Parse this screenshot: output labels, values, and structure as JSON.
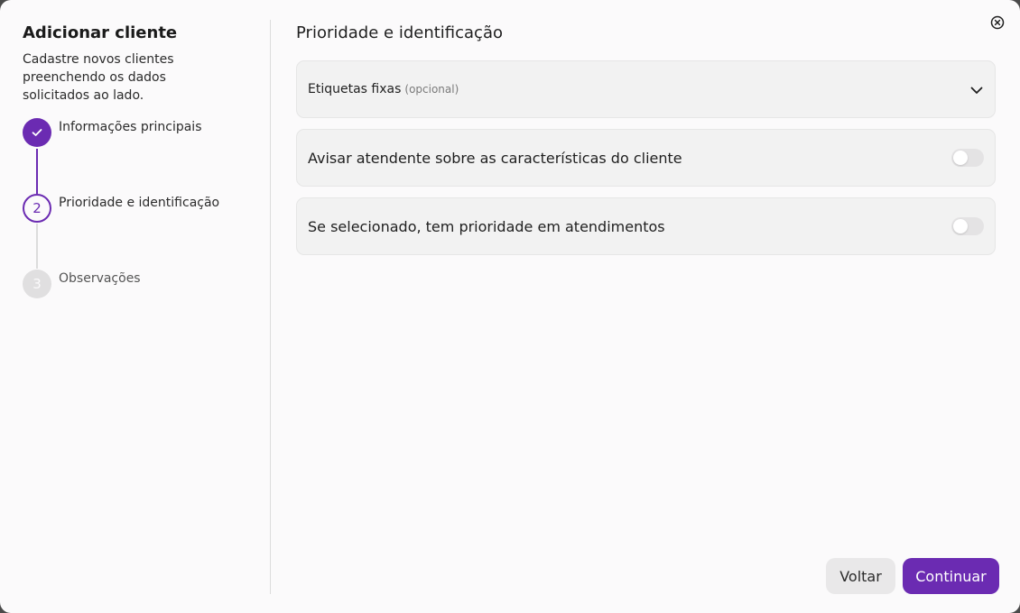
{
  "modal": {
    "title": "Adicionar cliente",
    "subtitle": "Cadastre novos clientes preenchendo os dados solicitados ao lado.",
    "close_icon": "close-circle-icon"
  },
  "steps": [
    {
      "number": "1",
      "label": "Informações principais",
      "status": "done",
      "icon": "check-icon"
    },
    {
      "number": "2",
      "label": "Prioridade e identificação",
      "status": "active"
    },
    {
      "number": "3",
      "label": "Observações",
      "status": "pending"
    }
  ],
  "main": {
    "section_title": "Prioridade e identificação",
    "tags_dropdown": {
      "label": "Etiquetas fixas",
      "optional": "(opcional)",
      "icon": "chevron-down-icon"
    },
    "toggles": [
      {
        "label": "Avisar atendente sobre as características do cliente",
        "checked": false
      },
      {
        "label": "Se selecionado, tem prioridade em atendimentos",
        "checked": false
      }
    ]
  },
  "footer": {
    "back_label": "Voltar",
    "continue_label": "Continuar"
  },
  "colors": {
    "accent": "#6b2bb2",
    "background": "#fbfafb",
    "card": "#f2f2f2",
    "pending": "#e0dfe0"
  }
}
